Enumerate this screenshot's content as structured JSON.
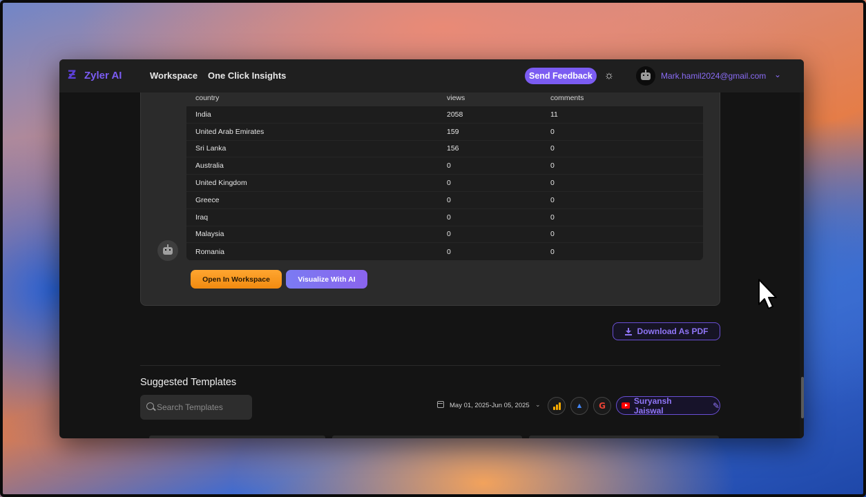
{
  "app": {
    "logo_text": "Zyler AI",
    "nav": [
      "Workspace",
      "One Click Insights"
    ],
    "send_feedback": "Send Feedback",
    "user_email": "Mark.hamil2024@gmail.com"
  },
  "table": {
    "headers": [
      "country",
      "views",
      "comments"
    ],
    "rows": [
      [
        "India",
        "2058",
        "11"
      ],
      [
        "United Arab Emirates",
        "159",
        "0"
      ],
      [
        "Sri Lanka",
        "156",
        "0"
      ],
      [
        "Australia",
        "0",
        "0"
      ],
      [
        "United Kingdom",
        "0",
        "0"
      ],
      [
        "Greece",
        "0",
        "0"
      ],
      [
        "Iraq",
        "0",
        "0"
      ],
      [
        "Malaysia",
        "0",
        "0"
      ],
      [
        "Romania",
        "0",
        "0"
      ]
    ]
  },
  "actions": {
    "open_workspace": "Open In Workspace",
    "visualize": "Visualize With AI",
    "download_pdf": "Download As PDF"
  },
  "templates": {
    "title": "Suggested Templates",
    "search_placeholder": "Search Templates",
    "date_range": "May 01, 2025-Jun 05, 2025",
    "profile_name": "Suryansh Jaiswal"
  },
  "icons": [
    "logo-icon",
    "sun-icon",
    "robot-avatar-icon",
    "download-icon",
    "search-icon",
    "calendar-icon",
    "chevron-down-icon",
    "google-analytics-icon",
    "google-ads-icon",
    "google-icon",
    "youtube-icon",
    "pencil-icon",
    "mouse-cursor-icon"
  ],
  "colors": {
    "accent": "#7b5cf2",
    "orange_button": "#f7971e",
    "window_bg": "#141414"
  }
}
